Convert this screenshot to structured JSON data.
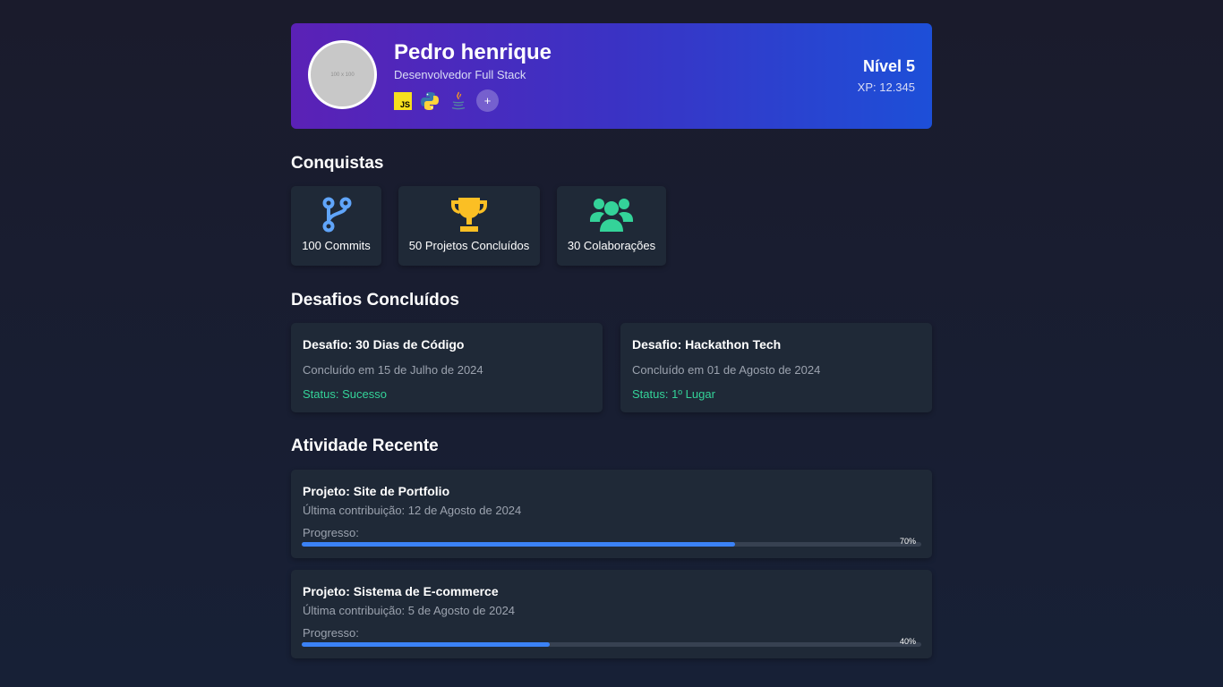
{
  "profile": {
    "avatar_placeholder": "100 x 100",
    "name": "Pedro henrique",
    "role": "Desenvolvedor Full Stack",
    "tech_icons": [
      "javascript-icon",
      "python-icon",
      "java-icon"
    ],
    "add_label": "+",
    "level": "Nível 5",
    "xp": "XP: 12.345"
  },
  "achievements": {
    "title": "Conquistas",
    "items": [
      {
        "label": "100 Commits",
        "icon": "git-branch-icon",
        "color": "#60a5fa"
      },
      {
        "label": "50 Projetos Concluídos",
        "icon": "trophy-icon",
        "color": "#fbbf24"
      },
      {
        "label": "30 Colaborações",
        "icon": "users-icon",
        "color": "#34d399"
      }
    ]
  },
  "challenges": {
    "title": "Desafios Concluídos",
    "items": [
      {
        "title": "Desafio: 30 Dias de Código",
        "date": "Concluído em 15 de Julho de 2024",
        "status": "Status: Sucesso"
      },
      {
        "title": "Desafio: Hackathon Tech",
        "date": "Concluído em 01 de Agosto de 2024",
        "status": "Status: 1º Lugar"
      }
    ]
  },
  "activity": {
    "title": "Atividade Recente",
    "items": [
      {
        "title": "Projeto: Site de Portfolio",
        "date": "Última contribuição: 12 de Agosto de 2024",
        "progress_label": "Progresso:",
        "progress": 0.7,
        "progress_text": "70%"
      },
      {
        "title": "Projeto: Sistema de E-commerce",
        "date": "Última contribuição: 5 de Agosto de 2024",
        "progress_label": "Progresso:",
        "progress": 0.4,
        "progress_text": "40%"
      }
    ]
  },
  "colors": {
    "accent": "#3b82f6",
    "success": "#34d399",
    "card_bg": "#1f2937"
  }
}
